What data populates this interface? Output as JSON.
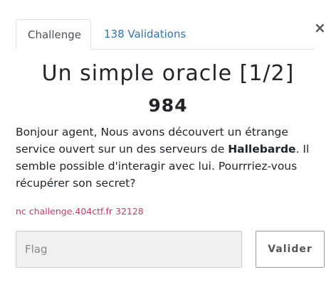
{
  "modal": {
    "close_label": "×"
  },
  "tabs": [
    {
      "label": "Challenge",
      "active": true
    },
    {
      "label": "138 Validations",
      "active": false
    }
  ],
  "challenge": {
    "title": "Un simple oracle [1/2]",
    "points": "984",
    "description_part1": "Bonjour agent, Nous avons découvert un étrange service ouvert sur un des serveurs de ",
    "description_bold": "Hallebarde",
    "description_part2": ". Il semble possible d'interagir avec lui. Pourrriez-vous récupérer son secret?",
    "connection": "nc challenge.404ctf.fr 32128"
  },
  "form": {
    "flag_placeholder": "Flag",
    "flag_value": "",
    "submit_label": "Valider"
  },
  "colors": {
    "tab_link": "#3173b4",
    "connection_text": "#d6336c",
    "input_bg": "#f0f0f0"
  }
}
